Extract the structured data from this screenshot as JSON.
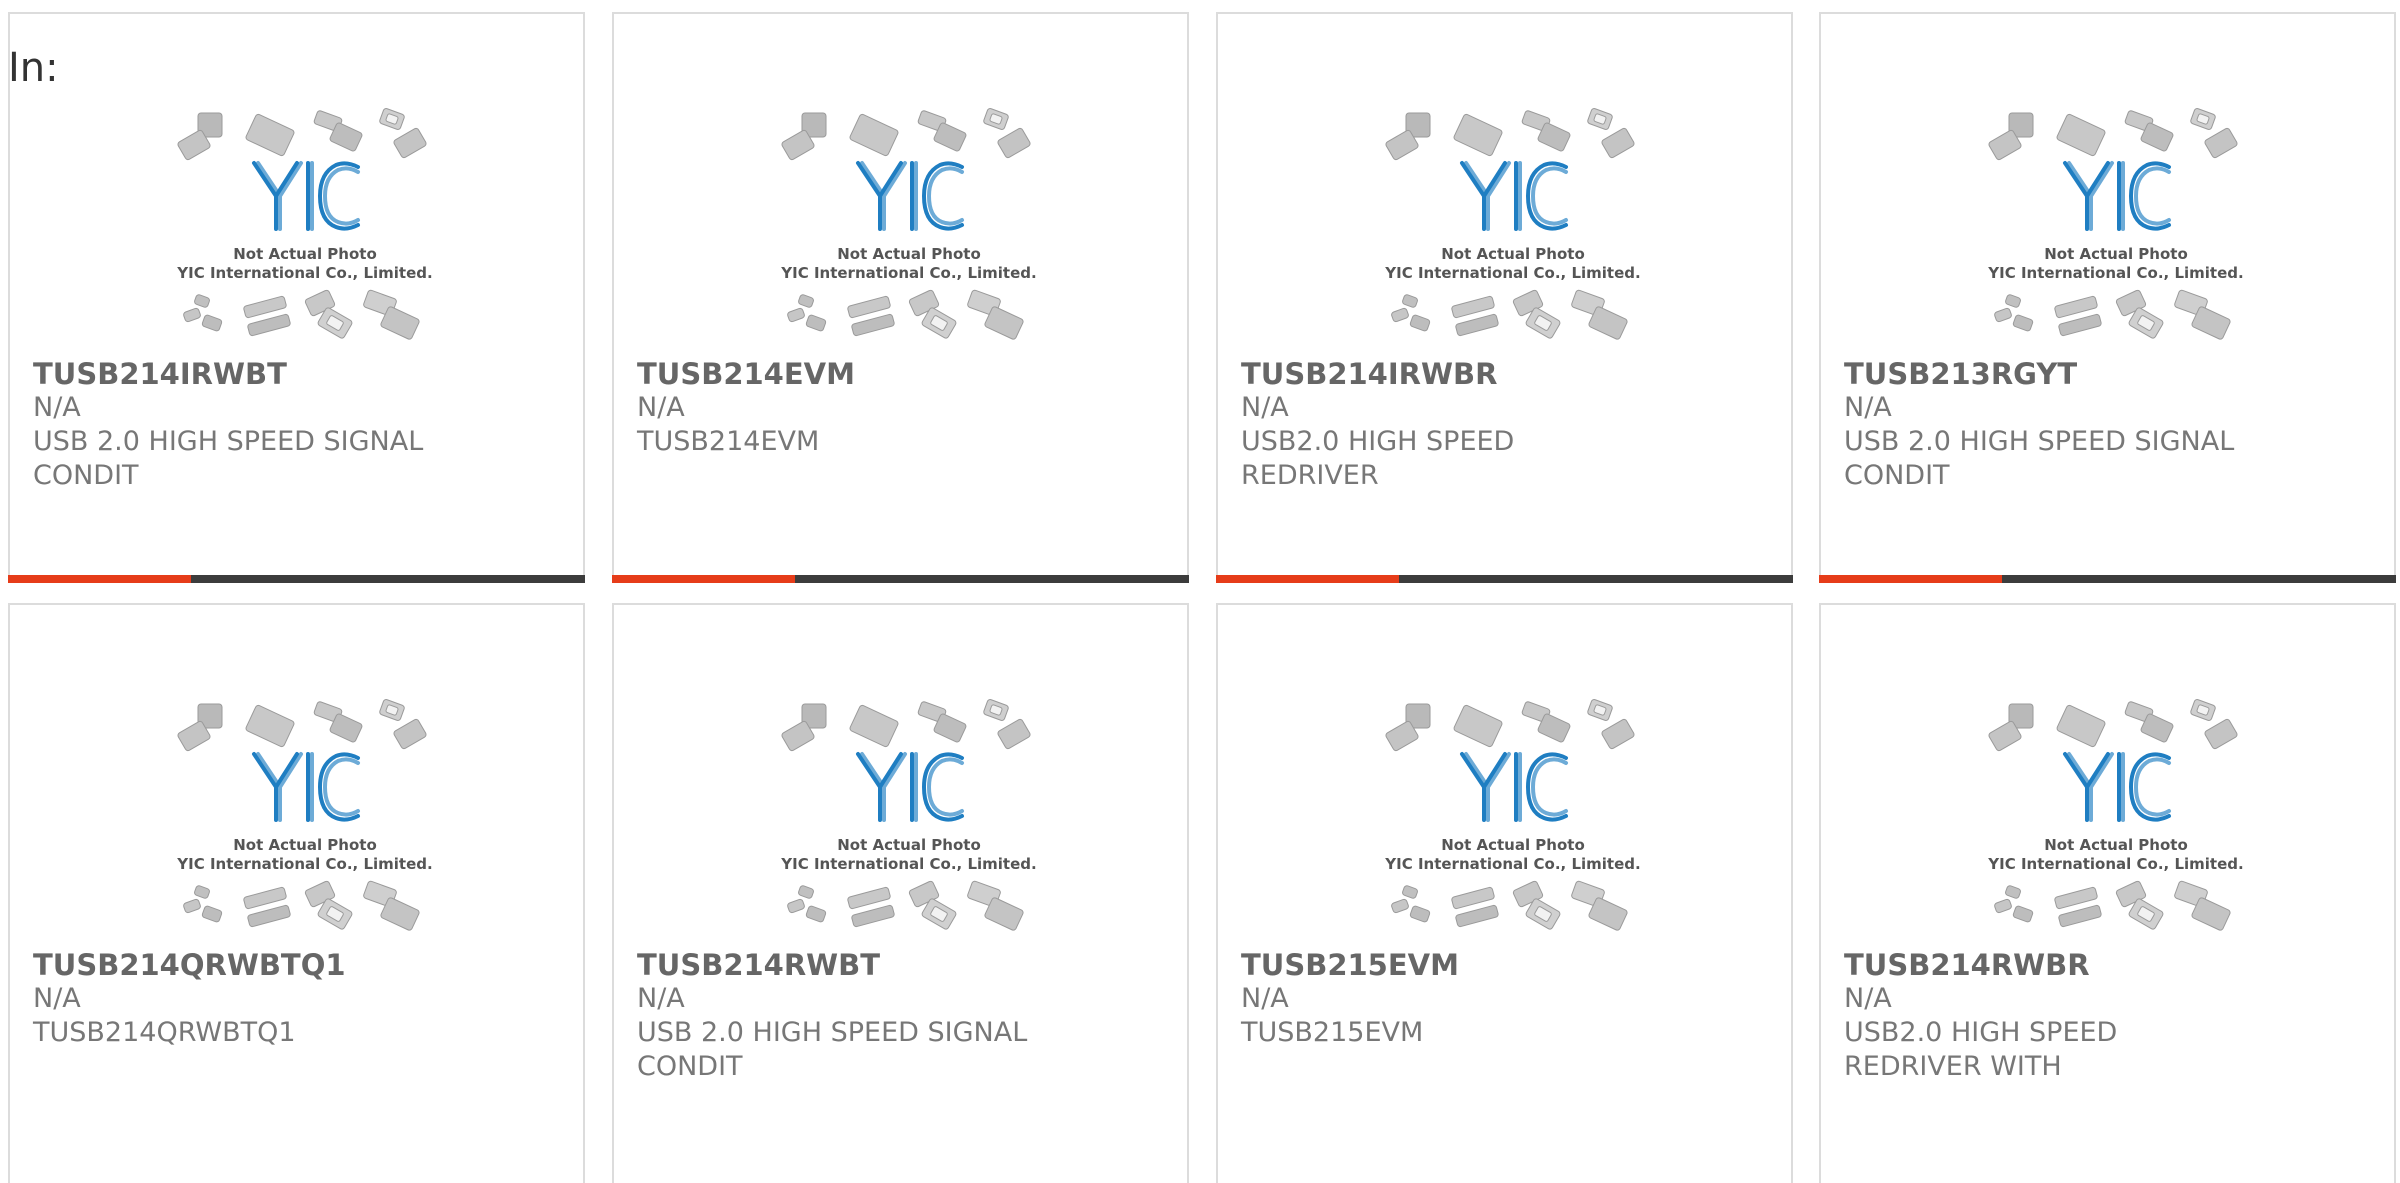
{
  "page": {
    "prefix_label": "In:",
    "placeholder": {
      "line1": "Not Actual Photo",
      "line2": "YIC International Co., Limited."
    }
  },
  "colors": {
    "accent": "#e63c19",
    "bar_dark": "#3c3c3c",
    "logo_blue": "#1f7ec2",
    "text_gray": "#777777"
  },
  "products": [
    {
      "name": "TUSB214IRWBT",
      "status": "N/A",
      "description": "USB 2.0 HIGH SPEED SIGNAL CONDIT"
    },
    {
      "name": "TUSB214EVM",
      "status": "N/A",
      "description": "TUSB214EVM"
    },
    {
      "name": "TUSB214IRWBR",
      "status": "N/A",
      "description": "USB2.0 HIGH SPEED REDRIVER"
    },
    {
      "name": "TUSB213RGYT",
      "status": "N/A",
      "description": "USB 2.0 HIGH SPEED SIGNAL CONDIT"
    },
    {
      "name": "TUSB214QRWBTQ1",
      "status": "N/A",
      "description": "TUSB214QRWBTQ1"
    },
    {
      "name": "TUSB214RWBT",
      "status": "N/A",
      "description": "USB 2.0 HIGH SPEED SIGNAL CONDIT"
    },
    {
      "name": "TUSB215EVM",
      "status": "N/A",
      "description": "TUSB215EVM"
    },
    {
      "name": "TUSB214RWBR",
      "status": "N/A",
      "description": "USB2.0 HIGH SPEED REDRIVER WITH"
    }
  ]
}
